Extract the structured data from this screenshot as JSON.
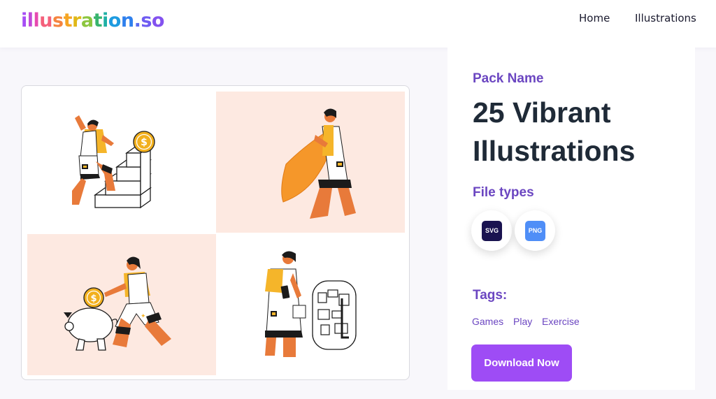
{
  "header": {
    "logo": {
      "text": "illustration.so",
      "letter_colors": [
        "#a64df5",
        "#c04ad8",
        "#e64ab0",
        "#f4607b",
        "#f5843f",
        "#f5a524",
        "#e0b818",
        "#8cc63f",
        "#38b46e",
        "#1fb0a5",
        "#1e9be0",
        "#2f80ed",
        "#5b6cf0",
        "#6f5cf2",
        "#8352ef"
      ]
    },
    "nav": [
      {
        "label": "Home"
      },
      {
        "label": "Illustrations"
      }
    ]
  },
  "preview": {
    "panel_colors": {
      "peach": "#fde9e1",
      "white": "#ffffff"
    },
    "accent_colors": {
      "orange": "#f0883f",
      "skin": "#e87a3a",
      "yellow": "#f5b52a",
      "coin": "#f2b01e",
      "dark": "#1b1b1b"
    },
    "icons": [
      "person-stairs-coin-icon",
      "person-shield-icon",
      "person-piggy-bank-icon",
      "person-phone-map-icon"
    ]
  },
  "pack": {
    "label": "Pack Name",
    "title": "25 Vibrant Illustrations",
    "file_types_label": "File types",
    "file_types": [
      {
        "label": "SVG",
        "color": "#1a1350"
      },
      {
        "label": "PNG",
        "color": "#4f8ef7"
      }
    ],
    "tags_label": "Tags:",
    "tags": [
      "Games",
      "Play",
      "Exercise"
    ],
    "download_label": "Download Now"
  }
}
